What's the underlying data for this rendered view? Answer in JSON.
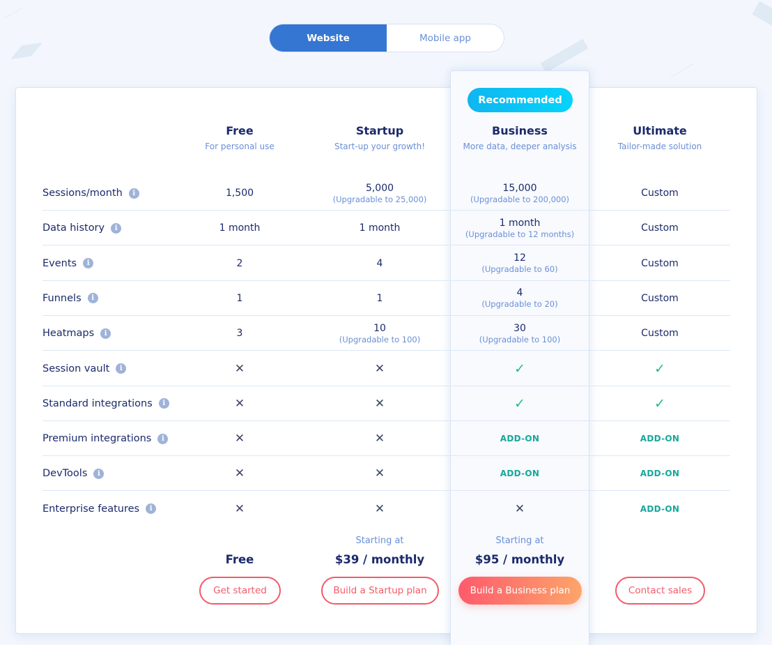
{
  "toggle": {
    "options": [
      {
        "label": "Website",
        "active": true
      },
      {
        "label": "Mobile app",
        "active": false
      }
    ]
  },
  "recommended_badge": "Recommended",
  "plans": [
    {
      "name": "Free",
      "subtitle": "For personal use",
      "price_label": "",
      "price": "Free",
      "cta": "Get started"
    },
    {
      "name": "Startup",
      "subtitle": "Start-up your growth!",
      "price_label": "Starting at",
      "price": "$39 / monthly",
      "cta": "Build a Startup plan"
    },
    {
      "name": "Business",
      "subtitle": "More data, deeper analysis",
      "price_label": "Starting at",
      "price": "$95 / monthly",
      "cta": "Build a Business plan"
    },
    {
      "name": "Ultimate",
      "subtitle": "Tailor-made solution",
      "price_label": "",
      "price": "",
      "cta": "Contact sales"
    }
  ],
  "info_icon": "i",
  "icons": {
    "no": "✕",
    "yes": "✓"
  },
  "features": [
    {
      "label": "Sessions/month",
      "values": [
        {
          "type": "text",
          "value": "1,500"
        },
        {
          "type": "text",
          "value": "5,000",
          "note": "(Upgradable to 25,000)"
        },
        {
          "type": "text",
          "value": "15,000",
          "note": "(Upgradable to 200,000)"
        },
        {
          "type": "text",
          "value": "Custom"
        }
      ]
    },
    {
      "label": "Data history",
      "values": [
        {
          "type": "text",
          "value": "1 month"
        },
        {
          "type": "text",
          "value": "1 month"
        },
        {
          "type": "text",
          "value": "1 month",
          "note": "(Upgradable to 12 months)"
        },
        {
          "type": "text",
          "value": "Custom"
        }
      ]
    },
    {
      "label": "Events",
      "values": [
        {
          "type": "text",
          "value": "2"
        },
        {
          "type": "text",
          "value": "4"
        },
        {
          "type": "text",
          "value": "12",
          "note": "(Upgradable to 60)"
        },
        {
          "type": "text",
          "value": "Custom"
        }
      ]
    },
    {
      "label": "Funnels",
      "values": [
        {
          "type": "text",
          "value": "1"
        },
        {
          "type": "text",
          "value": "1"
        },
        {
          "type": "text",
          "value": "4",
          "note": "(Upgradable to 20)"
        },
        {
          "type": "text",
          "value": "Custom"
        }
      ]
    },
    {
      "label": "Heatmaps",
      "values": [
        {
          "type": "text",
          "value": "3"
        },
        {
          "type": "text",
          "value": "10",
          "note": "(Upgradable to 100)"
        },
        {
          "type": "text",
          "value": "30",
          "note": "(Upgradable to 100)"
        },
        {
          "type": "text",
          "value": "Custom"
        }
      ]
    },
    {
      "label": "Session vault",
      "values": [
        {
          "type": "no"
        },
        {
          "type": "no"
        },
        {
          "type": "yes"
        },
        {
          "type": "yes"
        }
      ]
    },
    {
      "label": "Standard integrations",
      "values": [
        {
          "type": "no"
        },
        {
          "type": "no"
        },
        {
          "type": "yes"
        },
        {
          "type": "yes"
        }
      ]
    },
    {
      "label": "Premium integrations",
      "values": [
        {
          "type": "no"
        },
        {
          "type": "no"
        },
        {
          "type": "addon",
          "value": "ADD-ON"
        },
        {
          "type": "addon",
          "value": "ADD-ON"
        }
      ]
    },
    {
      "label": "DevTools",
      "values": [
        {
          "type": "no"
        },
        {
          "type": "no"
        },
        {
          "type": "addon",
          "value": "ADD-ON"
        },
        {
          "type": "addon",
          "value": "ADD-ON"
        }
      ]
    },
    {
      "label": "Enterprise features",
      "values": [
        {
          "type": "no"
        },
        {
          "type": "no"
        },
        {
          "type": "no"
        },
        {
          "type": "addon",
          "value": "ADD-ON"
        }
      ]
    }
  ],
  "colors": {
    "accent_blue": "#3576d2",
    "badge_cyan": "#0fb6ef",
    "check_green": "#22b88f",
    "addon_teal": "#17a79b",
    "cta_red": "#f25a6a",
    "cta_gradient_end": "#fca56a",
    "text_navy": "#1b2a6b",
    "text_muted": "#6a8fd6"
  }
}
